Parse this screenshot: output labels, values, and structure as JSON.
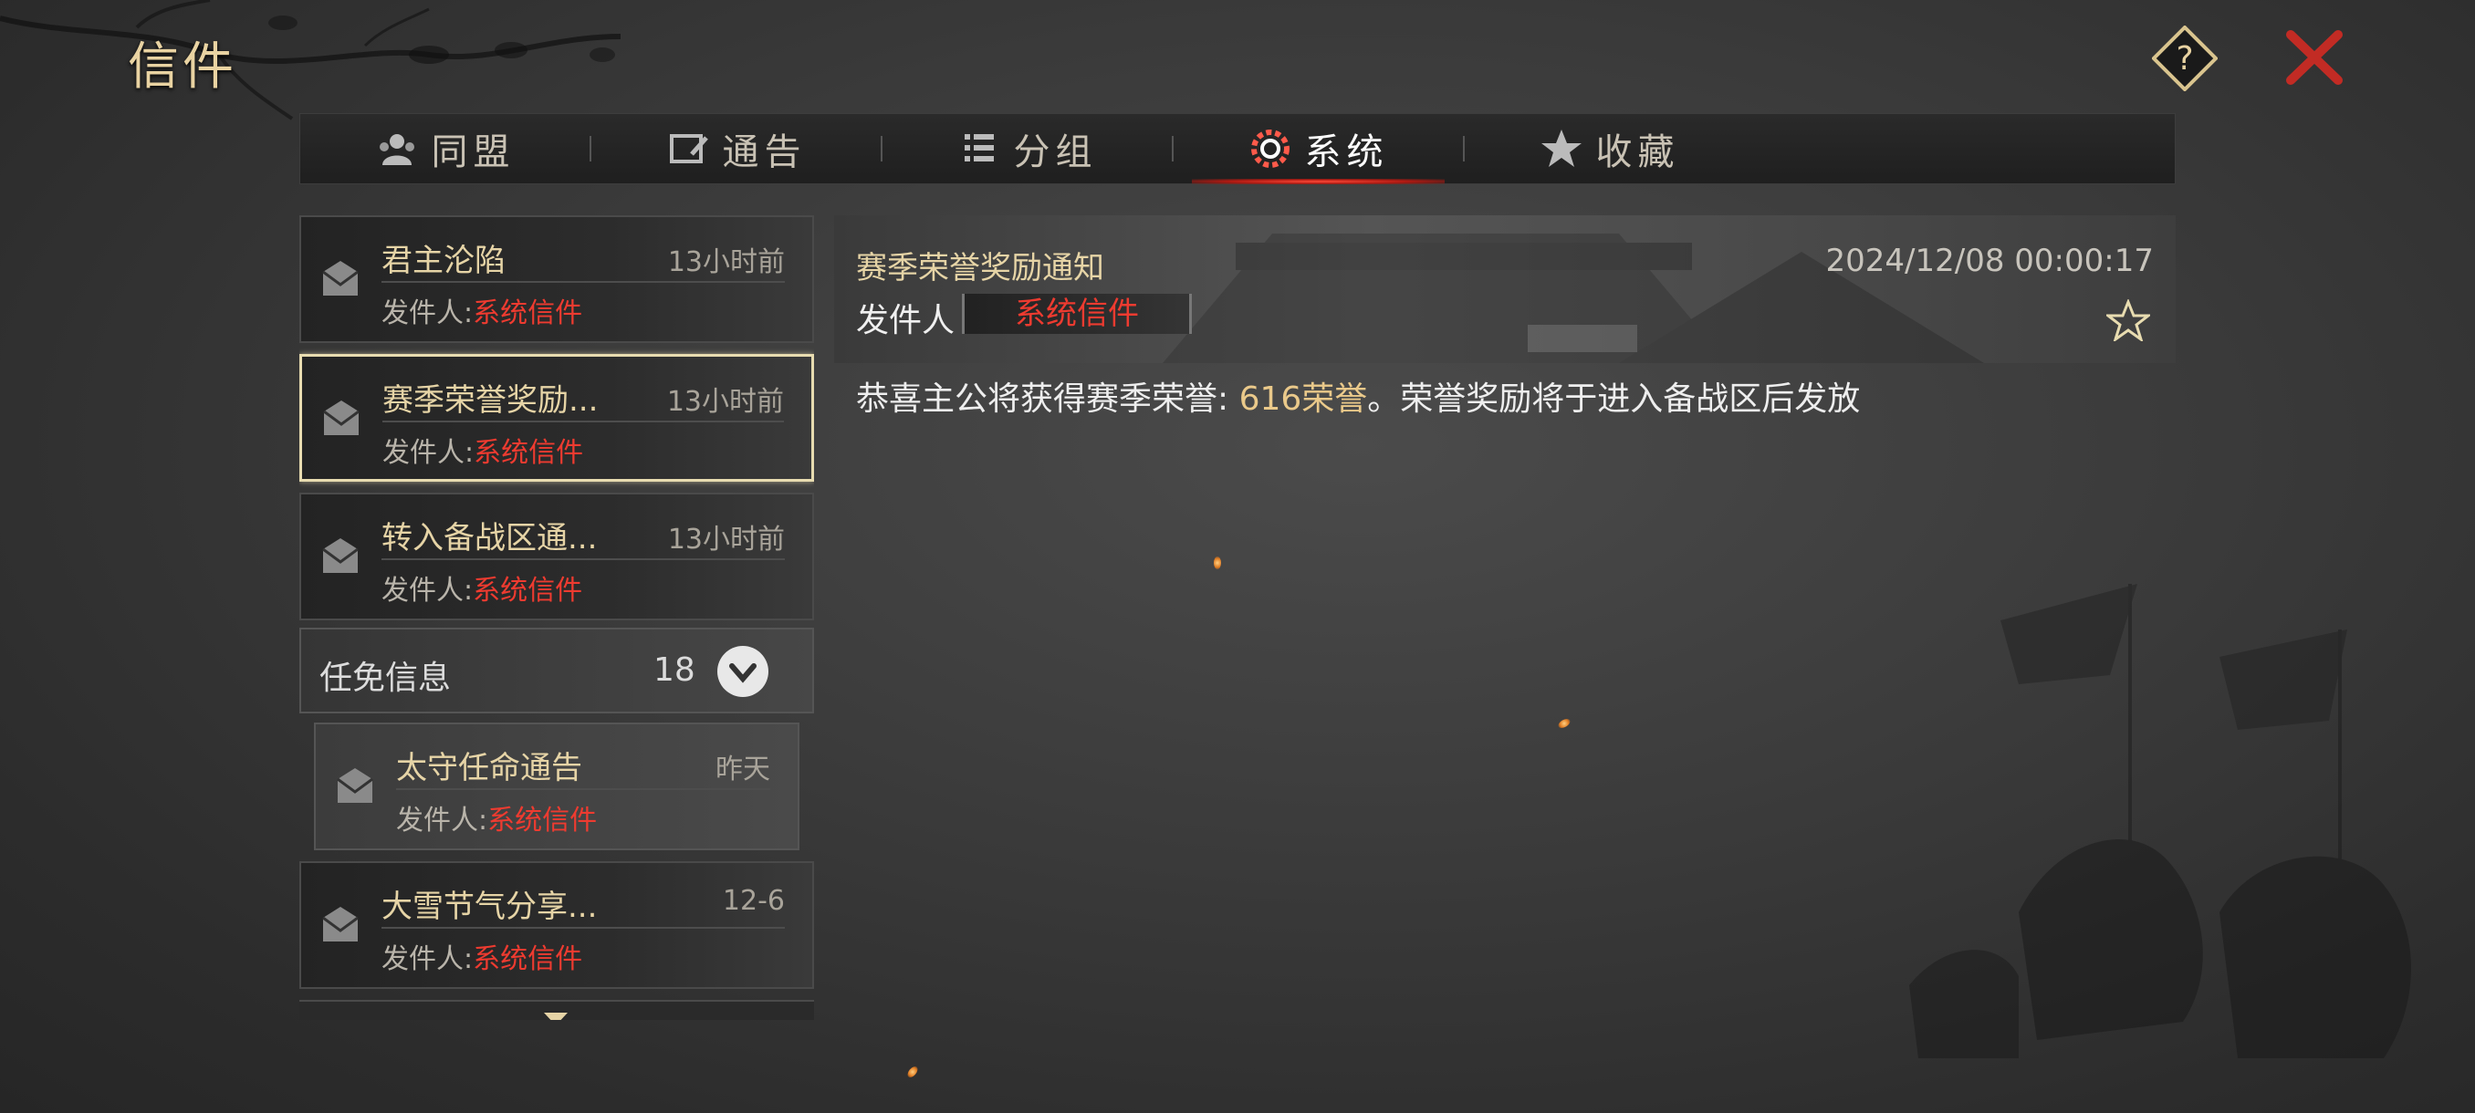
{
  "window": {
    "title": "信件"
  },
  "tabs": [
    {
      "label": "同盟",
      "icon": "alliance-icon",
      "active": false
    },
    {
      "label": "通告",
      "icon": "announcement-icon",
      "active": false
    },
    {
      "label": "分组",
      "icon": "group-icon",
      "active": false
    },
    {
      "label": "系统",
      "icon": "system-gear-icon",
      "active": true
    },
    {
      "label": "收藏",
      "icon": "star-icon",
      "active": false
    }
  ],
  "mails": [
    {
      "subject": "君主沦陷",
      "time": "13小时前",
      "sender_label": "发件人:",
      "sender": "系统信件"
    },
    {
      "subject": "赛季荣誉奖励...",
      "time": "13小时前",
      "sender_label": "发件人:",
      "sender": "系统信件",
      "selected": true
    },
    {
      "subject": "转入备战区通...",
      "time": "13小时前",
      "sender_label": "发件人:",
      "sender": "系统信件"
    }
  ],
  "group": {
    "name": "任免信息",
    "count": "18",
    "sub_mail": {
      "subject": "太守任命通告",
      "time": "昨天",
      "sender_label": "发件人:",
      "sender": "系统信件"
    }
  },
  "mail_after_group": {
    "subject": "大雪节气分享...",
    "time": "12-6",
    "sender_label": "发件人:",
    "sender": "系统信件"
  },
  "detail": {
    "subject": "赛季荣誉奖励通知",
    "date": "2024/12/08 00:00:17",
    "sender_label": "发件人",
    "sender": "系统信件",
    "body_prefix": "恭喜主公将获得赛季荣誉: ",
    "body_highlight": "616荣誉",
    "body_suffix": "。荣誉奖励将于进入备战区后发放"
  },
  "colors": {
    "accent_gold": "#e6d4a6",
    "sender_red": "#ee3b30",
    "tab_active": "#d4281c"
  }
}
